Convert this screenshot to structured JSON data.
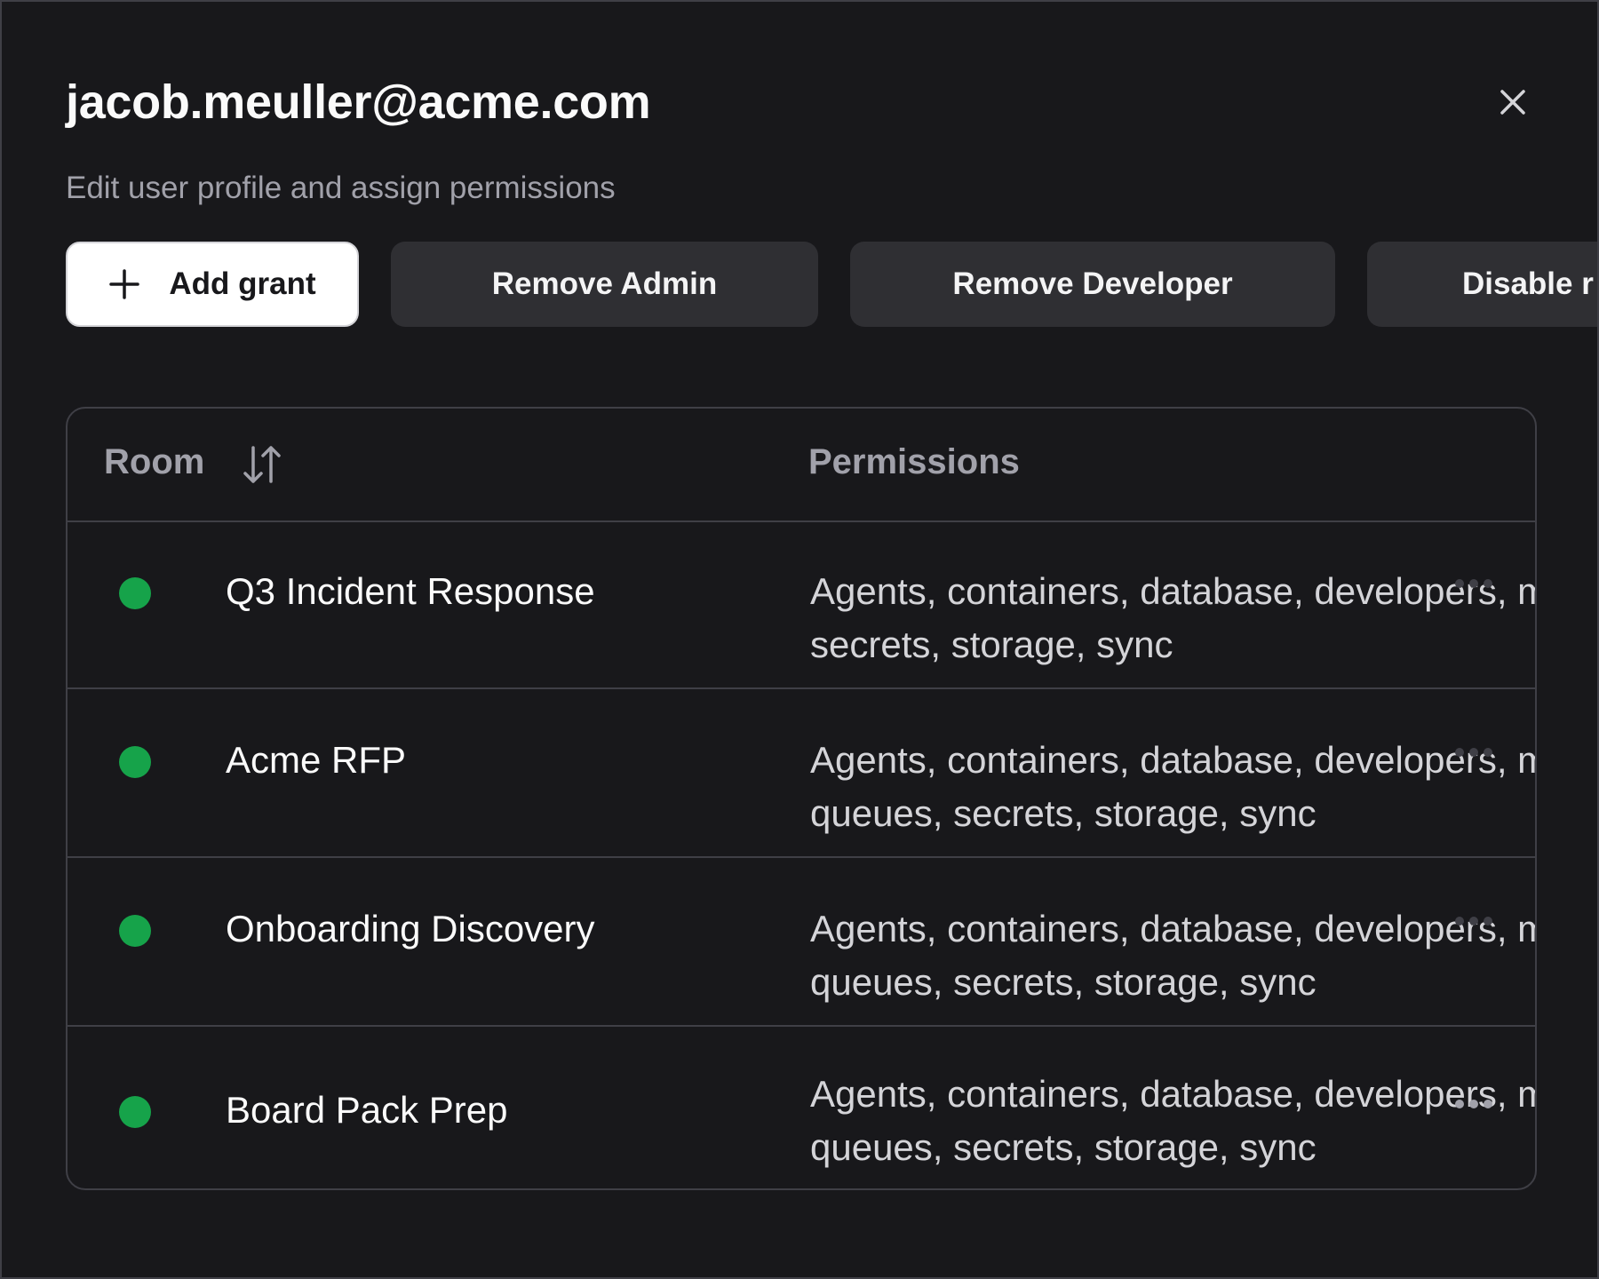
{
  "dialog": {
    "title": "jacob.meuller@acme.com",
    "subtitle": "Edit user profile and assign permissions",
    "close_icon": "close-icon"
  },
  "actions": {
    "add_grant": "Add grant",
    "remove_admin": "Remove Admin",
    "remove_developer": "Remove Developer",
    "disable": "Disable r"
  },
  "table": {
    "columns": {
      "room": "Room",
      "permissions": "Permissions"
    },
    "rows": [
      {
        "room": "Q3 Incident Response",
        "status": "active",
        "perm_line1": "Agents, containers, database, developers, m",
        "perm_line2": "secrets, storage, sync"
      },
      {
        "room": "Acme RFP",
        "status": "active",
        "perm_line1": "Agents, containers, database, developers, m",
        "perm_line2": "queues, secrets, storage, sync"
      },
      {
        "room": "Onboarding Discovery",
        "status": "active",
        "perm_line1": "Agents, containers, database, developers, m",
        "perm_line2": "queues, secrets, storage, sync"
      },
      {
        "room": "Board Pack Prep",
        "status": "active",
        "perm_line1": "Agents, containers, database, developers, m",
        "perm_line2": "queues, secrets, storage, sync"
      }
    ]
  },
  "colors": {
    "background": "#18181b",
    "status_active": "#16a34a",
    "primary_button": "#ffffff",
    "secondary_button": "#2f2f33"
  }
}
